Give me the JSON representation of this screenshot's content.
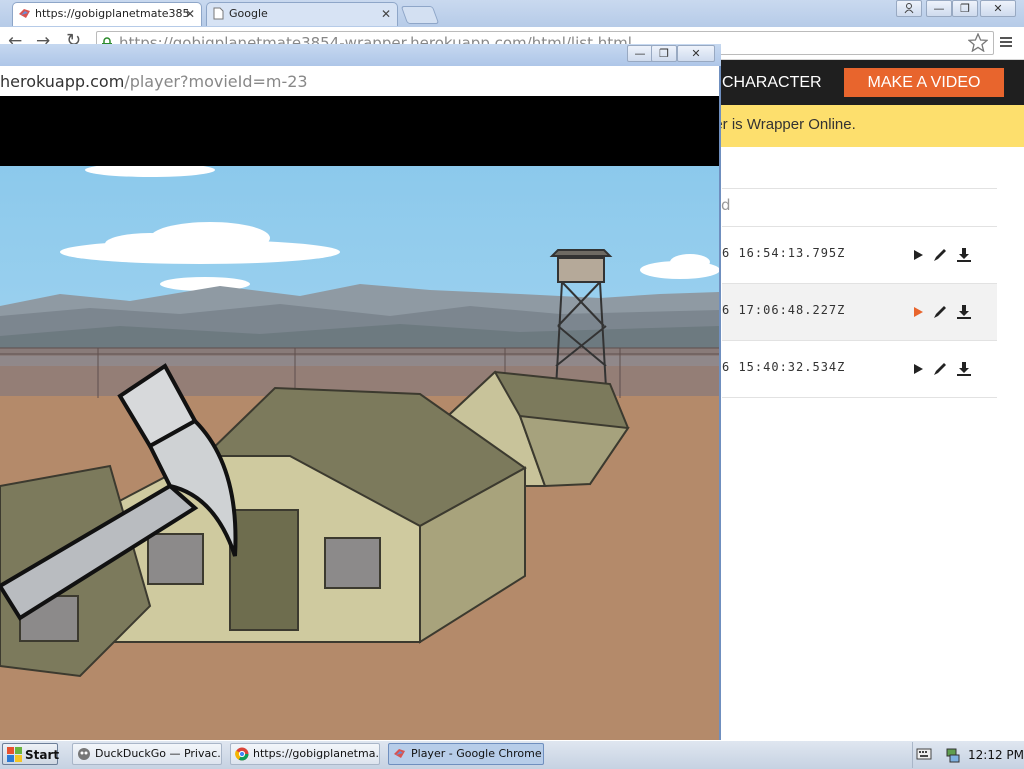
{
  "browser": {
    "tabs": [
      {
        "label": "https://gobigplanetmate385"
      },
      {
        "label": "Google"
      }
    ],
    "address": "https://gobigplanetmate3854-wrapper.herokuapp.com/html/list.html"
  },
  "page": {
    "nav": {
      "character_label": "CHARACTER",
      "make_video_label": "MAKE A VIDEO"
    },
    "notice": "per is Wrapper Online.",
    "sort_label": "d",
    "movies": [
      {
        "time": "6 16:54:13.795Z",
        "play_active": false
      },
      {
        "time": "6 17:06:48.227Z",
        "play_active": true
      },
      {
        "time": "6 15:40:32.534Z",
        "play_active": false
      }
    ]
  },
  "popup": {
    "url_host": "herokuapp.com",
    "url_path": "/player?movieId=m-23"
  },
  "taskbar": {
    "start_label": "Start",
    "items": [
      {
        "label": "DuckDuckGo — Privac..."
      },
      {
        "label": "https://gobigplanetma..."
      },
      {
        "label": "Player - Google Chrome"
      }
    ],
    "clock": "12:12 PM"
  },
  "colors": {
    "accent": "#e8652d",
    "notice_bg": "#fddf6d",
    "navbar_bg": "#1f1f1f",
    "sky": "#9fd4ef",
    "ground": "#b48a6a"
  }
}
